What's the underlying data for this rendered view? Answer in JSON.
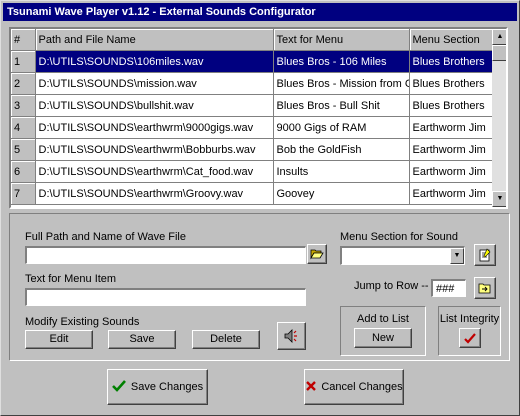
{
  "window": {
    "title": "Tsunami Wave Player v1.12 - External Sounds Configurator"
  },
  "grid": {
    "columns": [
      "#",
      "Path and File Name",
      "Text for Menu",
      "Menu Section"
    ],
    "rows": [
      {
        "num": "1",
        "path": "D:\\UTILS\\SOUNDS\\106miles.wav",
        "text": "Blues Bros - 106 Miles",
        "section": "Blues Brothers",
        "selected": true
      },
      {
        "num": "2",
        "path": "D:\\UTILS\\SOUNDS\\mission.wav",
        "text": "Blues Bros - Mission from God",
        "section": "Blues Brothers"
      },
      {
        "num": "3",
        "path": "D:\\UTILS\\SOUNDS\\bullshit.wav",
        "text": "Blues Bros - Bull Shit",
        "section": "Blues Brothers"
      },
      {
        "num": "4",
        "path": "D:\\UTILS\\SOUNDS\\earthwrm\\9000gigs.wav",
        "text": "9000 Gigs of RAM",
        "section": "Earthworm Jim"
      },
      {
        "num": "5",
        "path": "D:\\UTILS\\SOUNDS\\earthwrm\\Bobburbs.wav",
        "text": "Bob the GoldFish",
        "section": "Earthworm Jim"
      },
      {
        "num": "6",
        "path": "D:\\UTILS\\SOUNDS\\earthwrm\\Cat_food.wav",
        "text": "Insults",
        "section": "Earthworm Jim"
      },
      {
        "num": "7",
        "path": "D:\\UTILS\\SOUNDS\\earthwrm\\Groovy.wav",
        "text": "Goovey",
        "section": "Earthworm Jim"
      }
    ]
  },
  "form": {
    "full_path_label": "Full Path and Name of Wave File",
    "full_path_value": "",
    "menu_text_label": "Text for Menu Item",
    "menu_text_value": "",
    "menu_section_label": "Menu Section for Sound",
    "menu_section_value": "",
    "jump_label": "Jump to Row --",
    "jump_value": "###",
    "modify_label": "Modify Existing Sounds",
    "edit_label": "Edit",
    "save_label": "Save",
    "delete_label": "Delete",
    "add_label": "Add to List",
    "new_label": "New",
    "integrity_label": "List Integrity"
  },
  "footer": {
    "save_changes_label": "Save Changes",
    "cancel_changes_label": "Cancel Changes"
  },
  "icons": {
    "browse": "folder-open-icon",
    "section_edit": "notepad-icon",
    "jump": "folder-arrow-icon",
    "play": "speaker-icon",
    "integrity": "checkmark-icon",
    "save": "green-checkmark-icon",
    "cancel": "red-x-icon"
  },
  "colors": {
    "titlebar": "#000080",
    "selection": "#000080",
    "check_green": "#008000",
    "x_red": "#c00000"
  }
}
